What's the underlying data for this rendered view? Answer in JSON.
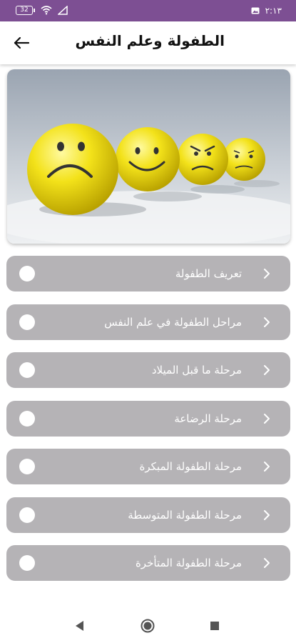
{
  "status_bar": {
    "battery_level": "32",
    "time": "٢:١٣",
    "colors": {
      "background": "#7d4f93"
    }
  },
  "app_bar": {
    "title": "الطفولة وعلم النفس",
    "back_icon": "arrow-left-icon"
  },
  "hero": {
    "image_description_icon": "emoji-balls-image"
  },
  "menu": {
    "items": [
      {
        "label": "تعريف الطفولة"
      },
      {
        "label": "مراحل الطفولة في علم النفس"
      },
      {
        "label": "مرحلة ما قبل الميلاد"
      },
      {
        "label": "مرحلة الرضاعة"
      },
      {
        "label": "مرحلة الطفولة المبكرة"
      },
      {
        "label": "مرحلة الطفولة المتوسطة"
      },
      {
        "label": "مرحلة الطفولة المتأخرة"
      }
    ],
    "colors": {
      "item_background": "#b5b3b6",
      "text": "#ffffff"
    }
  },
  "nav_bar": {
    "buttons": [
      "back-triangle-icon",
      "home-circle-icon",
      "recents-square-icon"
    ]
  }
}
